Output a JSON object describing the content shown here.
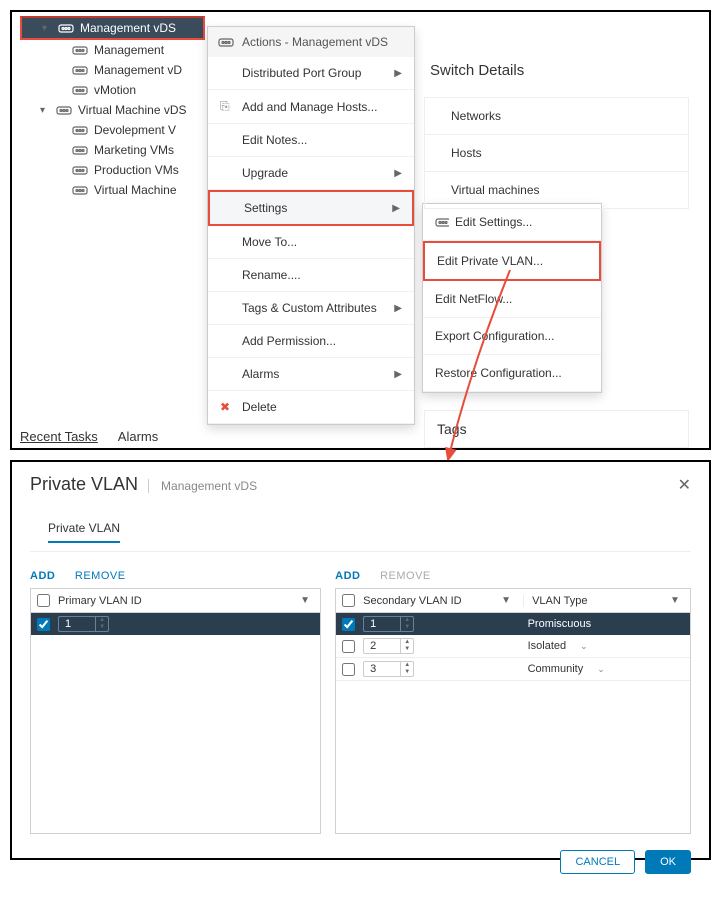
{
  "tree": {
    "items": [
      {
        "label": "Management vDS",
        "level": 1,
        "selected": true,
        "expandable": true
      },
      {
        "label": "Management",
        "level": 2
      },
      {
        "label": "Management vD",
        "level": 2
      },
      {
        "label": "vMotion",
        "level": 2
      },
      {
        "label": "Virtual Machine vDS",
        "level": 1,
        "expandable": true
      },
      {
        "label": "Devolepment V",
        "level": 2
      },
      {
        "label": "Marketing VMs",
        "level": 2
      },
      {
        "label": "Production VMs",
        "level": 2
      },
      {
        "label": "Virtual Machine",
        "level": 2
      }
    ]
  },
  "context_menu": {
    "header": "Actions - Management vDS",
    "items": [
      {
        "label": "Distributed Port Group",
        "submenu": true
      },
      {
        "label": "Add and Manage Hosts...",
        "icon": "hosts"
      },
      {
        "label": "Edit Notes..."
      },
      {
        "label": "Upgrade",
        "submenu": true
      },
      {
        "label": "Settings",
        "submenu": true,
        "highlighted": true
      },
      {
        "label": "Move To..."
      },
      {
        "label": "Rename...."
      },
      {
        "label": "Tags & Custom Attributes",
        "submenu": true
      },
      {
        "label": "Add Permission..."
      },
      {
        "label": "Alarms",
        "submenu": true
      },
      {
        "label": "Delete",
        "icon": "delete"
      }
    ]
  },
  "submenu": {
    "items": [
      {
        "label": "Edit Settings...",
        "icon": "settings"
      },
      {
        "label": "Edit Private VLAN...",
        "highlighted": true
      },
      {
        "label": "Edit NetFlow..."
      },
      {
        "label": "Export Configuration..."
      },
      {
        "label": "Restore Configuration..."
      }
    ]
  },
  "details_card": {
    "title": "Switch Details",
    "items": [
      "Networks",
      "Hosts",
      "Virtual machines"
    ]
  },
  "tags_title": "Tags",
  "bottom_tabs": [
    "Recent Tasks",
    "Alarms"
  ],
  "dialog": {
    "title": "Private VLAN",
    "subtitle": "Management vDS",
    "tab": "Private VLAN",
    "actions": {
      "add": "ADD",
      "remove": "REMOVE"
    },
    "left_header": "Primary VLAN ID",
    "right_headers": [
      "Secondary VLAN ID",
      "VLAN Type"
    ],
    "left_rows": [
      {
        "id": "1",
        "checked": true,
        "dark": true
      }
    ],
    "right_rows": [
      {
        "id": "1",
        "type": "Promiscuous",
        "checked": true,
        "dark": true,
        "dropdown": false
      },
      {
        "id": "2",
        "type": "Isolated",
        "checked": false,
        "dropdown": true
      },
      {
        "id": "3",
        "type": "Community",
        "checked": false,
        "dropdown": true
      }
    ],
    "buttons": {
      "cancel": "CANCEL",
      "ok": "OK"
    }
  }
}
